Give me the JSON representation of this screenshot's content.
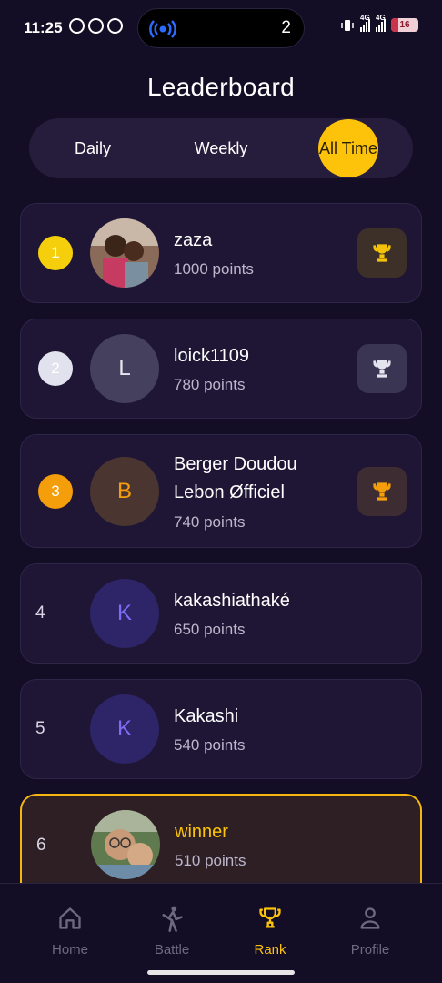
{
  "status_bar": {
    "time": "11:25",
    "island_count": "2",
    "network_1": "4G",
    "network_2": "4G",
    "battery": "16"
  },
  "page": {
    "title": "Leaderboard"
  },
  "tabs": [
    {
      "label": "Daily",
      "active": false
    },
    {
      "label": "Weekly",
      "active": false
    },
    {
      "label": "All Time",
      "active": true
    }
  ],
  "leaderboard": [
    {
      "rank": "1",
      "name": "zaza",
      "name_line2": "",
      "points": "1000 points",
      "avatar_letter": "",
      "avatar_type": "photo",
      "trophy": "gold"
    },
    {
      "rank": "2",
      "name": "loick1109",
      "name_line2": "",
      "points": "780 points",
      "avatar_letter": "L",
      "avatar_type": "letter",
      "trophy": "silver"
    },
    {
      "rank": "3",
      "name": "Berger Doudou",
      "name_line2": "Lebon Øfficiel",
      "points": "740 points",
      "avatar_letter": "B",
      "avatar_type": "letter",
      "trophy": "bronze"
    },
    {
      "rank": "4",
      "name": "kakashiathaké",
      "name_line2": "",
      "points": "650 points",
      "avatar_letter": "K",
      "avatar_type": "letter",
      "trophy": ""
    },
    {
      "rank": "5",
      "name": "Kakashi",
      "name_line2": "",
      "points": "540 points",
      "avatar_letter": "K",
      "avatar_type": "letter",
      "trophy": ""
    },
    {
      "rank": "6",
      "name": "winner",
      "name_line2": "",
      "points": "510 points",
      "avatar_letter": "",
      "avatar_type": "photo",
      "trophy": "",
      "is_current_user": true
    }
  ],
  "bottom_nav": [
    {
      "label": "Home",
      "icon": "home-icon",
      "active": false
    },
    {
      "label": "Battle",
      "icon": "battle-icon",
      "active": false
    },
    {
      "label": "Rank",
      "icon": "trophy-icon",
      "active": true
    },
    {
      "label": "Profile",
      "icon": "profile-icon",
      "active": false
    }
  ],
  "colors": {
    "background": "#140d26",
    "card": "#1e1634",
    "accent": "#fcc30a",
    "gold": "#f5cf0b",
    "silver": "#e2e2ee",
    "bronze": "#f59e0b",
    "avatar_purple": "#2e2468"
  }
}
